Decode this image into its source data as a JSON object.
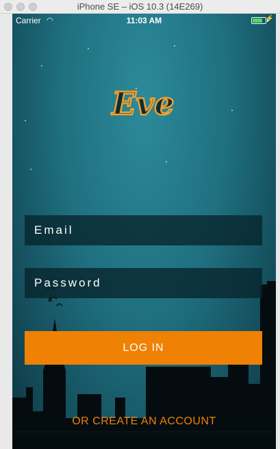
{
  "simulator": {
    "title": "iPhone SE – iOS 10.3 (14E269)"
  },
  "status_bar": {
    "carrier": "Carrier",
    "time": "11:03 AM",
    "battery_level": 0.7
  },
  "app": {
    "logo_text": "Eve"
  },
  "login_form": {
    "email_placeholder": "Email",
    "password_placeholder": "Password",
    "login_label": "LOG IN",
    "create_account_label": "OR CREATE AN ACCOUNT"
  },
  "colors": {
    "accent": "#ef8105",
    "background": "#1f6f7f",
    "field_bg": "#08242c"
  }
}
